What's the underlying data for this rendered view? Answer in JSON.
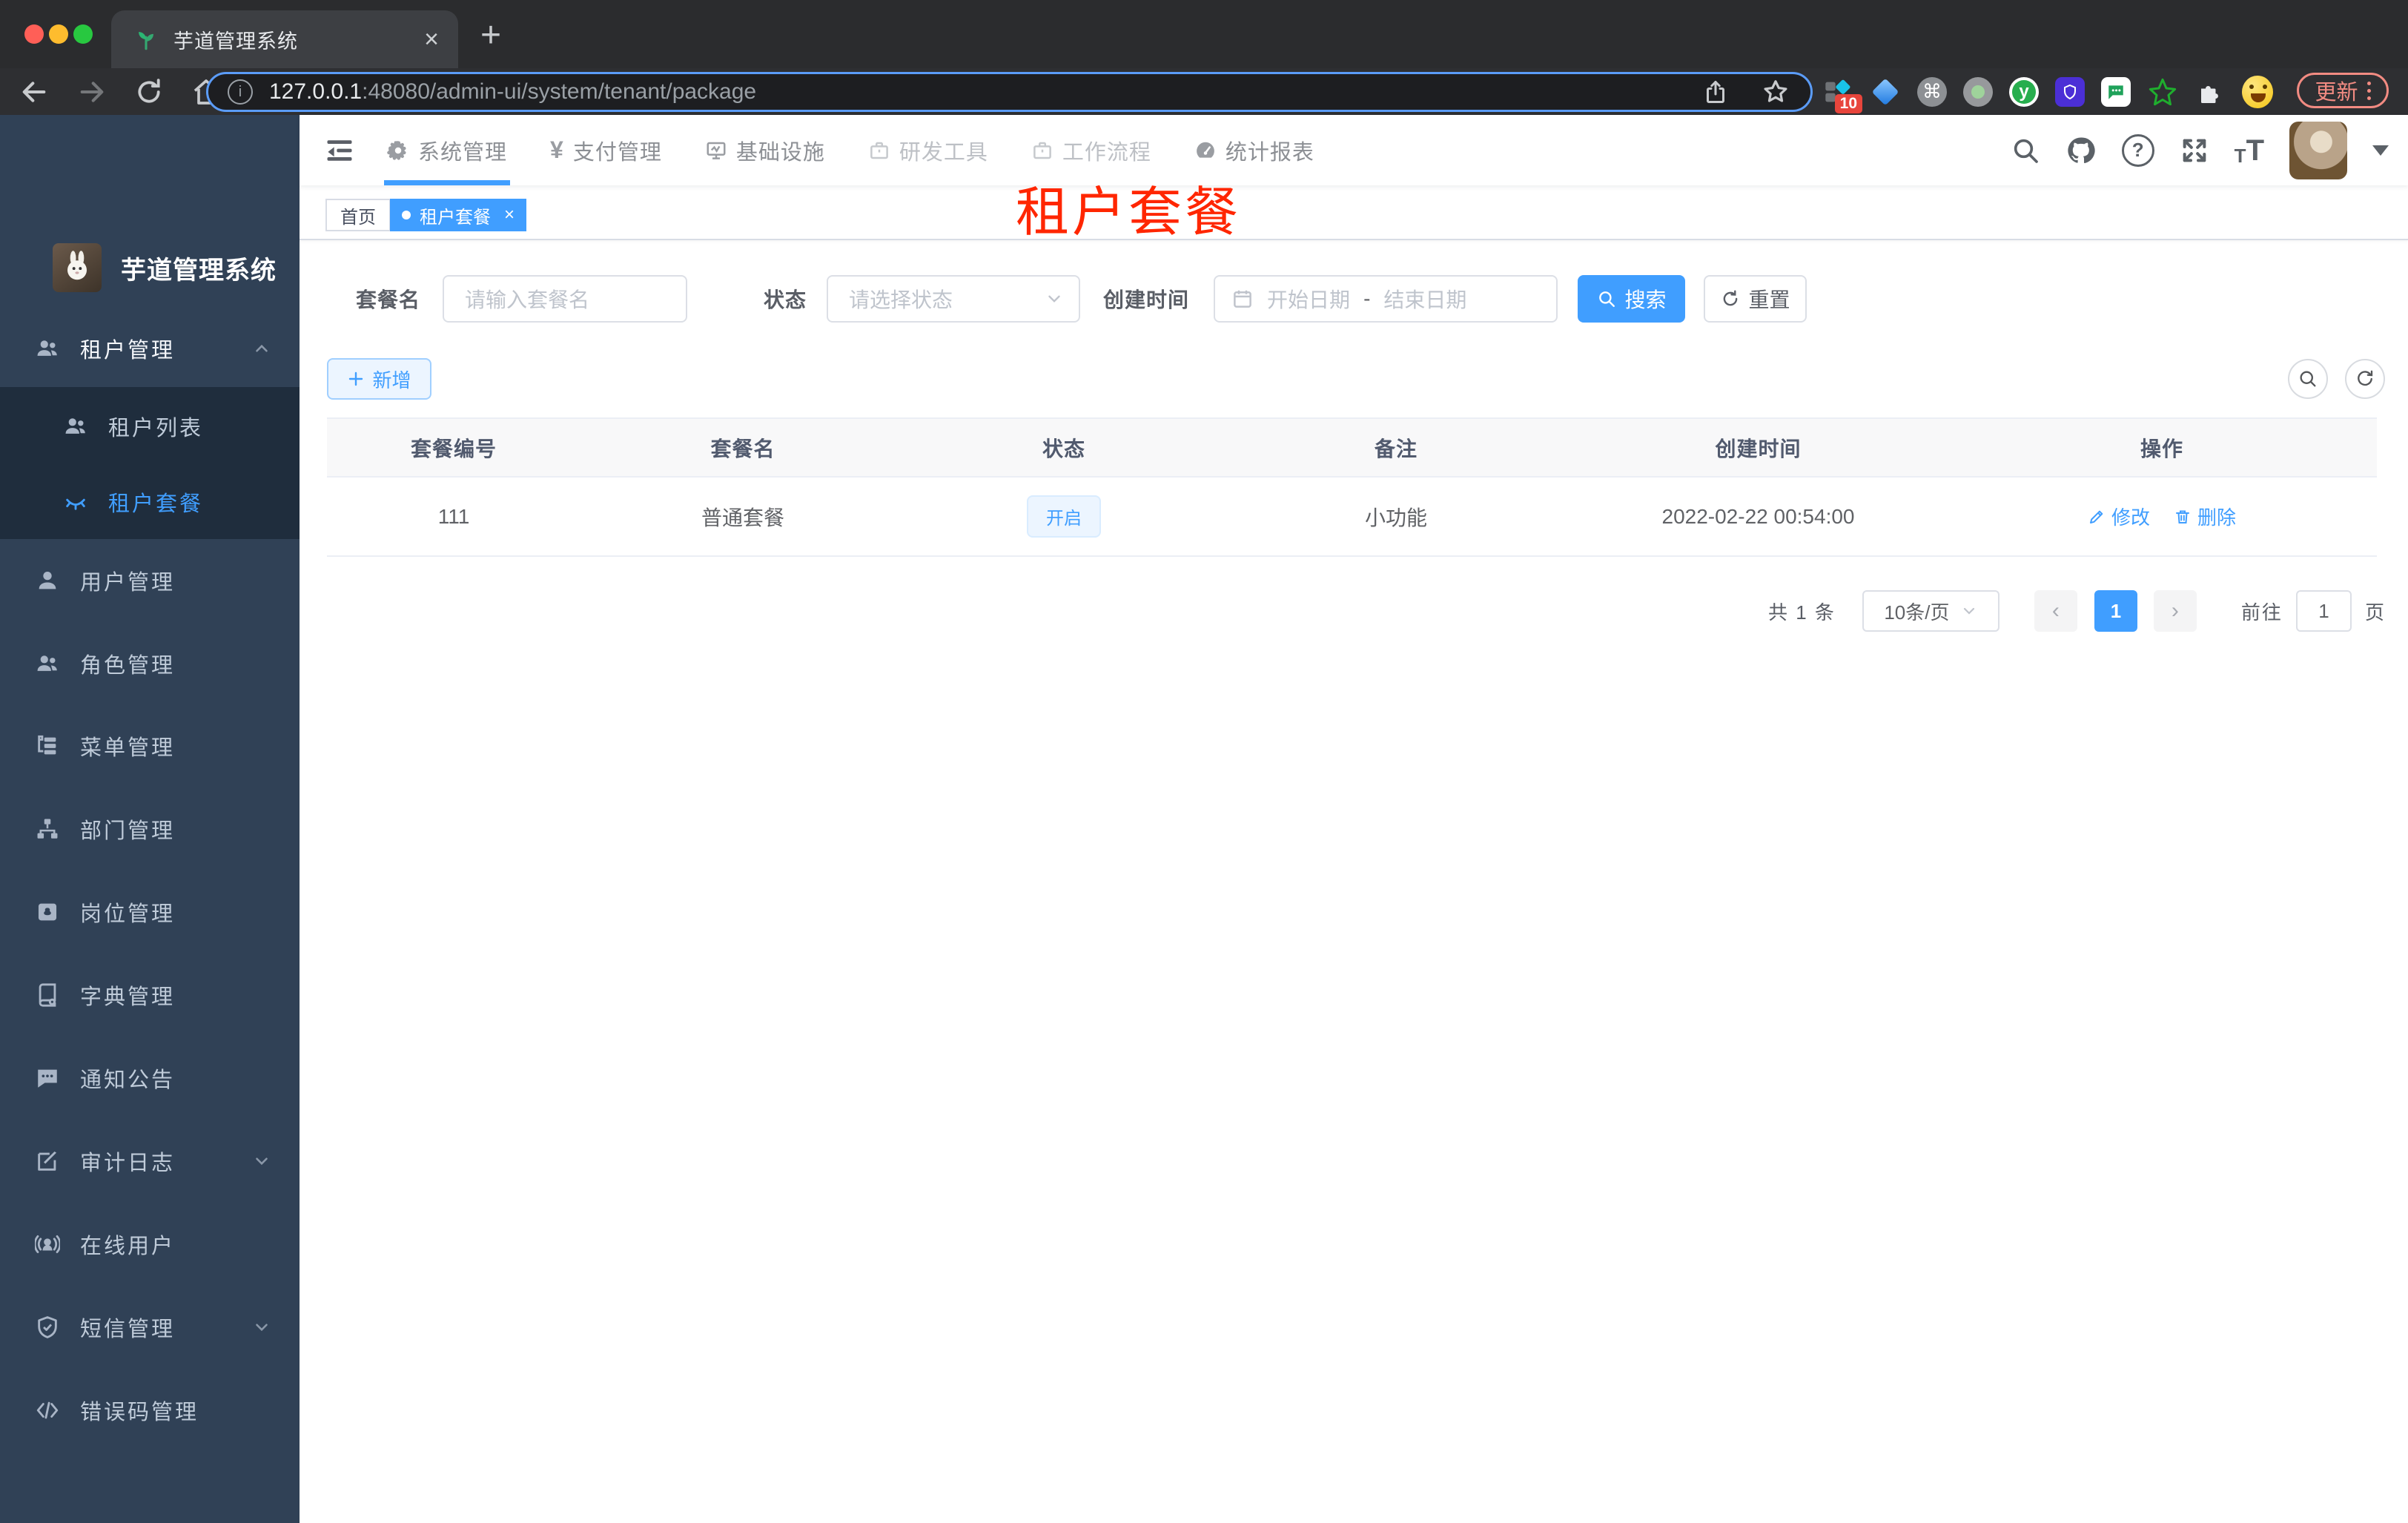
{
  "browser": {
    "tab_title": "芋道管理系统",
    "tab_close": "×",
    "new_tab": "+",
    "url_host": "127.0.0.1",
    "url_rest": ":48080/admin-ui/system/tenant/package",
    "extension_badge": "10",
    "update_label": "更新"
  },
  "sidebar": {
    "logo_title": "芋道管理系统",
    "parent": {
      "label": "租户管理"
    },
    "submenu": [
      {
        "label": "租户列表"
      },
      {
        "label": "租户套餐"
      }
    ],
    "items": [
      {
        "label": "用户管理"
      },
      {
        "label": "角色管理"
      },
      {
        "label": "菜单管理"
      },
      {
        "label": "部门管理"
      },
      {
        "label": "岗位管理"
      },
      {
        "label": "字典管理"
      },
      {
        "label": "通知公告"
      },
      {
        "label": "审计日志"
      },
      {
        "label": "在线用户"
      },
      {
        "label": "短信管理"
      },
      {
        "label": "错误码管理"
      }
    ]
  },
  "topnav": {
    "items": [
      {
        "label": "系统管理"
      },
      {
        "label": "支付管理"
      },
      {
        "label": "基础设施"
      },
      {
        "label": "研发工具"
      },
      {
        "label": "工作流程"
      },
      {
        "label": "统计报表"
      }
    ]
  },
  "tags": {
    "home": "首页",
    "active": "租户套餐",
    "close": "×"
  },
  "annotation": "租户套餐",
  "filters": {
    "name_label": "套餐名",
    "name_placeholder": "请输入套餐名",
    "status_label": "状态",
    "status_placeholder": "请选择状态",
    "date_label": "创建时间",
    "date_start": "开始日期",
    "date_sep": "-",
    "date_end": "结束日期",
    "search": "搜索",
    "reset": "重置"
  },
  "toolbar": {
    "add": "新增"
  },
  "table": {
    "headers": [
      "套餐编号",
      "套餐名",
      "状态",
      "备注",
      "创建时间",
      "操作"
    ],
    "rows": [
      {
        "id": "111",
        "name": "普通套餐",
        "status": "开启",
        "remark": "小功能",
        "created_at": "2022-02-22 00:54:00",
        "edit": "修改",
        "delete": "删除"
      }
    ]
  },
  "pagination": {
    "total": "共 1 条",
    "page_size": "10条/页",
    "prev": "‹",
    "page": "1",
    "next": "›",
    "goto_label": "前往",
    "goto_value": "1",
    "unit": "页"
  },
  "colors": {
    "accent": "#409eff",
    "sidebar_bg": "#304156",
    "submenu_bg": "#1f2d3d",
    "sidebar_text": "#bfcbd9",
    "tag_bg": "#ecf5ff",
    "tag_border": "#d9ecff",
    "annotation_red": "#ff2600",
    "update_chip": "#f28b82",
    "traffic_red": "#ff5f57",
    "traffic_yellow": "#febc2e",
    "traffic_green": "#28c840"
  }
}
